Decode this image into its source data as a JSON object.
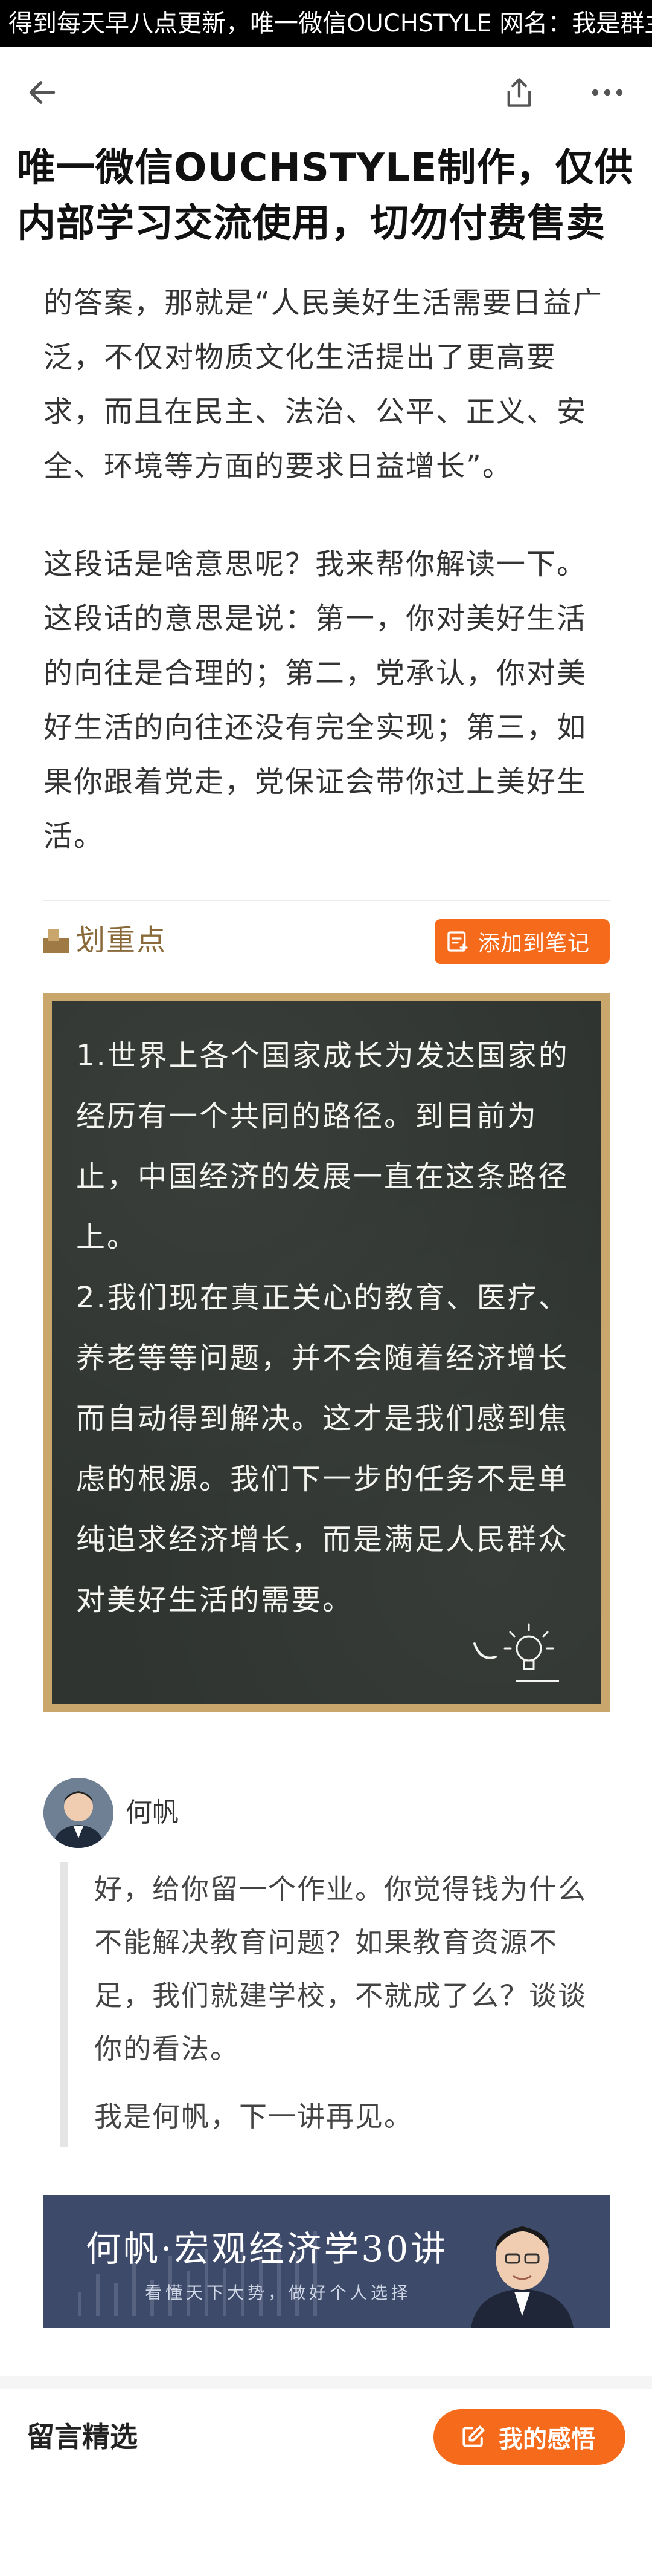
{
  "top_banner": {
    "text": "得到每天早八点更新，唯一微信OUCHSTYLE 网名：我是群主"
  },
  "navbar": {
    "back_icon": "arrow-left-icon",
    "share_icon": "share-icon",
    "more_icon": "more-dots-icon"
  },
  "watermark_title": {
    "line1": "唯一微信OUCHSTYLE制作，仅供",
    "line2": "内部学习交流使用，切勿付费售卖"
  },
  "article": {
    "paragraph1": "的答案，那就是“人民美好生活需要日益广泛，不仅对物质文化生活提出了更高要求，而且在民主、法治、公平、正义、安全、环境等方面的要求日益增长”。",
    "paragraph2": "这段话是啥意思呢？我来帮你解读一下。这段话的意思是说：第一，你对美好生活的向往是合理的；第二，党承认，你对美好生活的向往还没有完全实现；第三，如果你跟着党走，党保证会带你过上美好生活。"
  },
  "highlight": {
    "title": "划重点",
    "add_note_label": "添加到笔记",
    "point1": "1.世界上各个国家成长为发达国家的经历有一个共同的路径。到目前为止，中国经济的发展一直在这条路径上。",
    "point2": "2.我们现在真正关心的教育、医疗、养老等等问题，并不会随着经济增长而自动得到解决。这才是我们感到焦虑的根源。我们下一步的任务不是单纯追求经济增长，而是满足人民群众对美好生活的需要。"
  },
  "author": {
    "name": "何帆",
    "message": "好，给你留一个作业。你觉得钱为什么不能解决教育问题？如果教育资源不足，我们就建学校，不就成了么？谈谈你的看法。",
    "signoff": "我是何帆，下一讲再见。"
  },
  "course_banner": {
    "title": "何帆·宏观经济学30讲",
    "subtitle": "看懂天下大势，做好个人选择"
  },
  "comments": {
    "section_title": "留言精选",
    "my_insight_label": "我的感悟"
  },
  "colors": {
    "accent": "#f56a1b",
    "chalkboard": "#2f3430",
    "frame": "#c9a66b",
    "banner_bg": "#3e4a6a"
  }
}
